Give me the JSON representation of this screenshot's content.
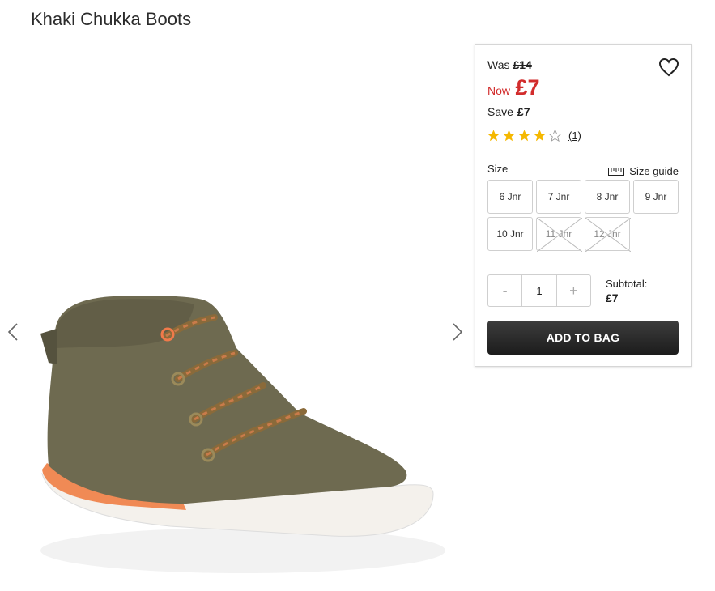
{
  "product": {
    "title": "Khaki Chukka Boots"
  },
  "pricing": {
    "was_label": "Was",
    "was_price": "£14",
    "now_label": "Now",
    "now_price": "£7",
    "save_label": "Save",
    "save_price": "£7"
  },
  "rating": {
    "stars": 4,
    "max": 5,
    "count": "(1)"
  },
  "size": {
    "label": "Size",
    "guide_label": "Size guide",
    "options": [
      {
        "label": "6 Jnr",
        "available": true
      },
      {
        "label": "7 Jnr",
        "available": true
      },
      {
        "label": "8 Jnr",
        "available": true
      },
      {
        "label": "9 Jnr",
        "available": true
      },
      {
        "label": "10 Jnr",
        "available": true
      },
      {
        "label": "11 Jnr",
        "available": false
      },
      {
        "label": "12 Jnr",
        "available": false
      }
    ]
  },
  "quantity": {
    "minus": "-",
    "value": "1",
    "plus": "+"
  },
  "subtotal": {
    "label": "Subtotal:",
    "value": "£7"
  },
  "actions": {
    "add_to_bag": "ADD TO BAG"
  },
  "icons": {
    "prev": "chevron-left-icon",
    "next": "chevron-right-icon",
    "wishlist": "heart-icon",
    "size_guide": "ruler-icon"
  },
  "colors": {
    "price_red": "#d22c2c",
    "star": "#f5b800",
    "button": "#2a2a2a"
  }
}
